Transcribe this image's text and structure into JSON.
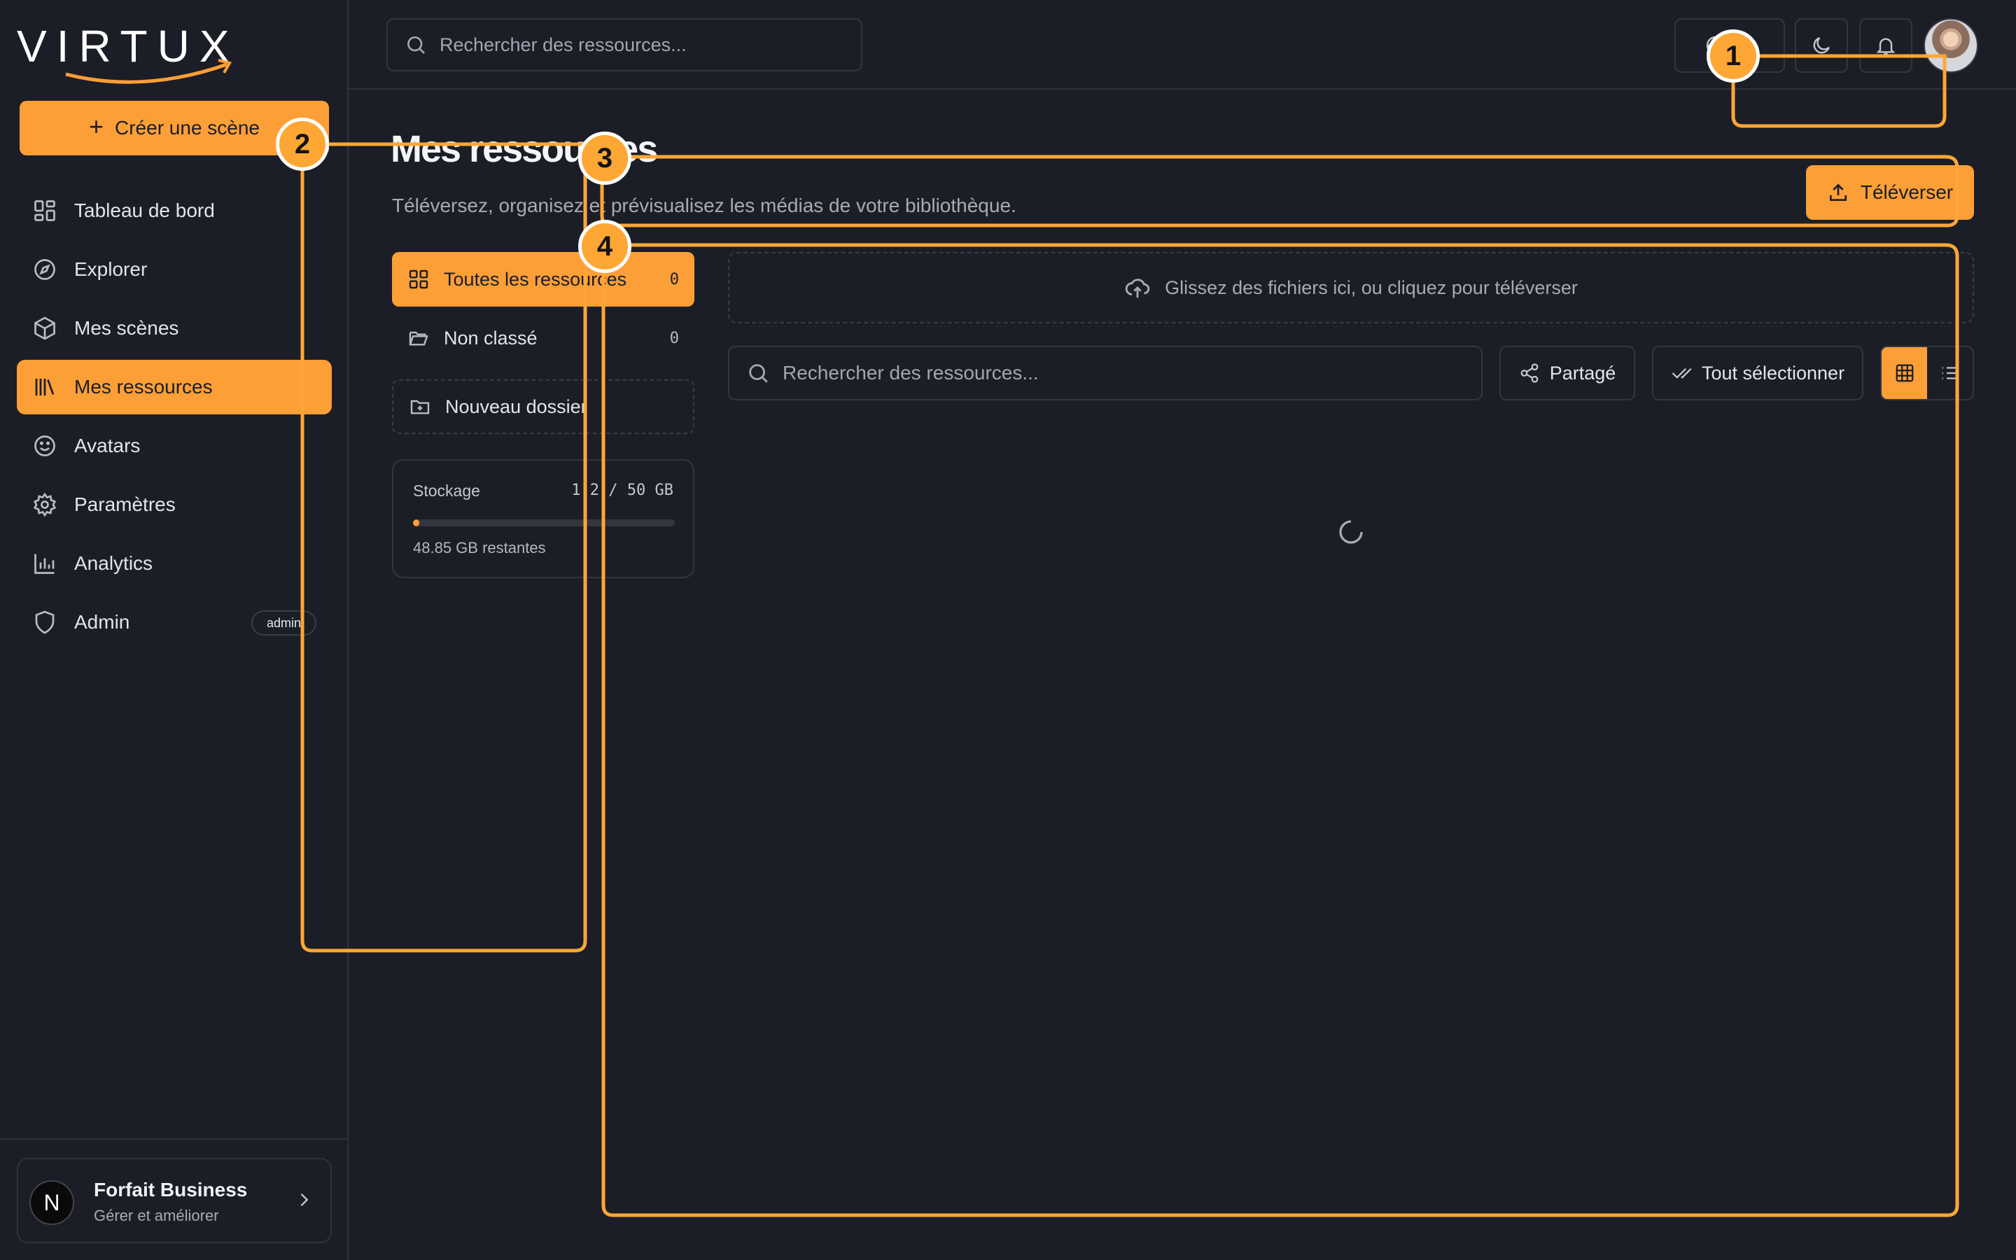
{
  "app": {
    "logo_text": "VIRTUX"
  },
  "sidebar": {
    "create_label": "Créer une scène",
    "items": [
      {
        "label": "Tableau de bord",
        "icon": "dashboard-icon"
      },
      {
        "label": "Explorer",
        "icon": "compass-icon"
      },
      {
        "label": "Mes scènes",
        "icon": "cube-icon"
      },
      {
        "label": "Mes ressources",
        "icon": "library-icon",
        "active": true
      },
      {
        "label": "Avatars",
        "icon": "smiley-icon"
      },
      {
        "label": "Paramètres",
        "icon": "gear-icon"
      },
      {
        "label": "Analytics",
        "icon": "bar-chart-icon"
      },
      {
        "label": "Admin",
        "icon": "shield-icon",
        "badge": "admin"
      }
    ],
    "plan": {
      "initial": "N",
      "title": "Forfait Business",
      "subtitle": "Gérer et améliorer"
    }
  },
  "topbar": {
    "search_placeholder": "Rechercher des ressources..."
  },
  "main": {
    "title": "Mes ressources",
    "subtitle": "Téléversez, organisez et prévisualisez les médias de votre bibliothèque.",
    "upload_label": "Téléverser",
    "folders": [
      {
        "label": "Toutes les ressources",
        "count": "0",
        "active": true
      },
      {
        "label": "Non classé",
        "count": "0"
      }
    ],
    "new_folder_label": "Nouveau dossier",
    "storage": {
      "label": "Stockage",
      "value": "1.2 / 50 GB",
      "used_fraction": 0.024,
      "remaining": "48.85 GB restantes"
    },
    "dropzone_label": "Glissez des fichiers ici, ou cliquez pour téléverser",
    "search_placeholder": "Rechercher des ressources...",
    "shared_label": "Partagé",
    "select_all_label": "Tout sélectionner",
    "view_mode": "grid"
  },
  "annotations": [
    "1",
    "2",
    "3",
    "4"
  ],
  "colors": {
    "accent": "#fd9f37",
    "background": "#1c1e27",
    "annotation": "#fea735"
  }
}
